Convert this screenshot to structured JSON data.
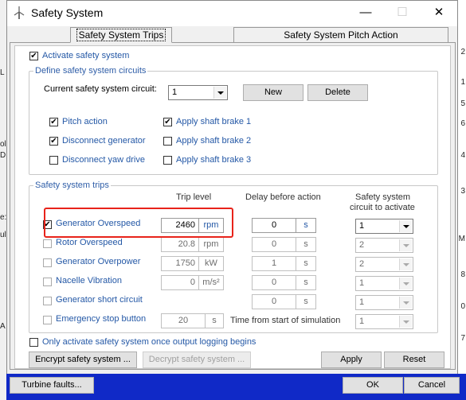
{
  "window": {
    "title": "Safety System",
    "minimize": "—",
    "maximize": "☐",
    "close": "✕"
  },
  "tabs": [
    {
      "label": "Safety System Trips"
    },
    {
      "label": "Safety System Pitch Action"
    }
  ],
  "activate_safety_system": {
    "label": "Activate safety system",
    "checked": "✔"
  },
  "define_circuits": {
    "group_label": "Define safety system circuits",
    "current_circuit_label": "Current safety system circuit:",
    "current_circuit_value": "1",
    "new_label": "New",
    "delete_label": "Delete",
    "options": [
      {
        "label": "Pitch action",
        "checked": "✔"
      },
      {
        "label": "Disconnect generator",
        "checked": "✔"
      },
      {
        "label": "Disconnect yaw drive",
        "checked": ""
      },
      {
        "label": "Apply shaft brake 1",
        "checked": "✔"
      },
      {
        "label": "Apply shaft brake 2",
        "checked": ""
      },
      {
        "label": "Apply shaft brake 3",
        "checked": ""
      }
    ]
  },
  "trips": {
    "group_label": "Safety system trips",
    "headers": {
      "trip_level": "Trip level",
      "delay": "Delay before action",
      "circuit_line1": "Safety system",
      "circuit_line2": "circuit to activate"
    },
    "rows": [
      {
        "label": "Generator Overspeed",
        "checked": "✔",
        "level": "2460",
        "unit": "rpm",
        "delay": "0",
        "delay_unit": "s",
        "circuit": "1"
      },
      {
        "label": "Rotor Overspeed",
        "checked": "",
        "level": "20.8",
        "unit": "rpm",
        "delay": "0",
        "delay_unit": "s",
        "circuit": "2"
      },
      {
        "label": "Generator Overpower",
        "checked": "",
        "level": "1750",
        "unit": "kW",
        "delay": "1",
        "delay_unit": "s",
        "circuit": "2"
      },
      {
        "label": "Nacelle Vibration",
        "checked": "",
        "level": "0",
        "unit": "m/s²",
        "delay": "0",
        "delay_unit": "s",
        "circuit": "1"
      },
      {
        "label": "Generator short circuit",
        "checked": "",
        "level": "",
        "unit": "",
        "delay": "0",
        "delay_unit": "s",
        "circuit": "1"
      },
      {
        "label": "Emergency stop button",
        "checked": "",
        "level": "20",
        "unit": "s",
        "delay_text": "Time from start of simulation",
        "circuit": "1"
      }
    ]
  },
  "only_activate_logging": {
    "label": "Only activate safety system once output logging begins",
    "checked": ""
  },
  "buttons": {
    "encrypt": "Encrypt safety system ...",
    "decrypt": "Decrypt safety system ...",
    "apply": "Apply",
    "reset": "Reset",
    "turbine_faults": "Turbine faults...",
    "ok": "OK",
    "cancel": "Cancel"
  },
  "colors": {
    "accent_blue": "#2458a6",
    "highlight_red": "#e8231a",
    "taskbar_blue": "#1029c7"
  }
}
